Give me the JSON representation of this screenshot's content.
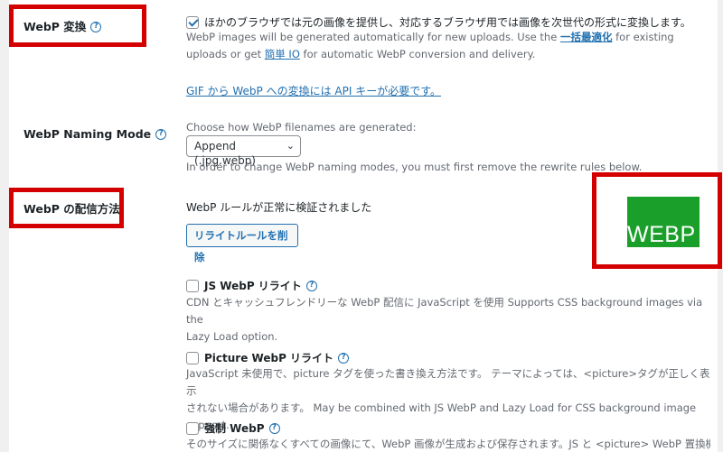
{
  "webp_convert": {
    "label": "WebP 変換",
    "checkbox_label": "ほかのブラウザでは元の画像を提供し、対応するブラウザ用では画像を次世代の形式に変換します。",
    "desc_1": "WebP images will be generated automatically for new uploads. Use the ",
    "link_bulk": "一括最適化",
    "desc_2": " for existing uploads or get ",
    "link_easy": "簡単 IO",
    "desc_3": " for automatic WebP conversion and delivery.",
    "gif_link": "GIF から WebP への変換には API キーが必要です。"
  },
  "naming_mode": {
    "label": "WebP Naming Mode",
    "prompt": "Choose how WebP filenames are generated:",
    "selected": "Append (.jpg.webp)",
    "note": "In order to change WebP naming modes, you must first remove the rewrite rules below."
  },
  "delivery": {
    "label": "WebP の配信方法",
    "status": "WebP ルールが正常に検証されました",
    "remove_button": "リライトルールを削除",
    "logo_text": "WEBP",
    "logo_color": "#1aa02a",
    "js_label": "JS WebP リライト",
    "js_desc_1": "CDN とキャッシュフレンドリーな WebP 配信に JavaScript を使用 Supports CSS background images via the",
    "js_desc_2": "Lazy Load option.",
    "picture_label": "Picture WebP リライト",
    "picture_desc_1": "JavaScript 未使用で、picture タグを使った書き換え方法です。 テーマによっては、<picture>タグが正しく表示",
    "picture_desc_2": "されない場合があります。 May be combined with JS WebP and Lazy Load for CSS background image support.",
    "force_label": "強制 WebP",
    "force_desc": "そのサイズに関係なくすべての画像にて、WebP 画像が生成および保存されます。JS と <picture> WebP 置換機"
  },
  "colors": {
    "highlight": "#d40000",
    "link": "#2271b1"
  }
}
